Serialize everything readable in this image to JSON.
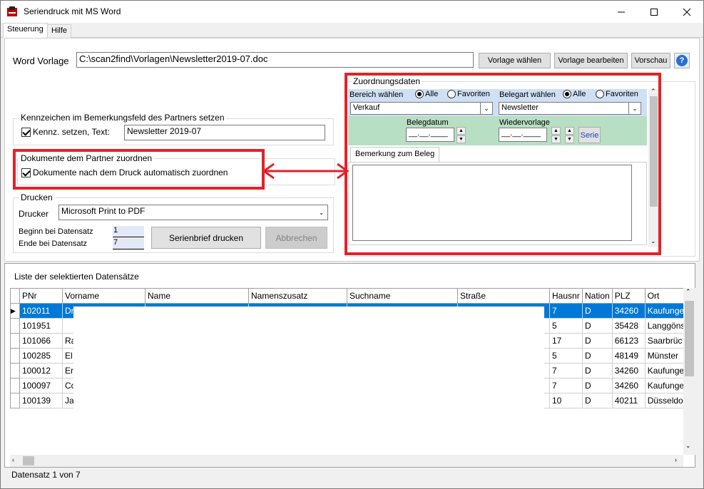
{
  "window": {
    "title": "Seriendruck mit MS Word"
  },
  "tabs": [
    {
      "label": "Steuerung"
    },
    {
      "label": "Hilfe"
    }
  ],
  "vorlage": {
    "label": "Word Vorlage",
    "path": "C:\\scan2find\\Vorlagen\\Newsletter2019-07.doc",
    "btn_waehlen": "Vorlage wählen",
    "btn_bearbeiten": "Vorlage bearbeiten",
    "btn_vorschau": "Vorschau",
    "help": "?"
  },
  "kennzeichen": {
    "group": "Kennzeichen im Bemerkungsfeld des Partners setzen",
    "checkbox": "Kennz. setzen, Text:",
    "text": "Newsletter 2019-07"
  },
  "dokumente": {
    "group": "Dokumente dem Partner zuordnen",
    "checkbox": "Dokumente nach dem Druck automatisch zuordnen"
  },
  "drucken": {
    "group": "Drucken",
    "drucker_label": "Drucker",
    "drucker": "Microsoft Print to PDF",
    "beginn_label": "Beginn bei Datensatz",
    "beginn": "1",
    "ende_label": "Ende bei Datensatz",
    "ende": "7",
    "btn_drucken": "Serienbrief drucken",
    "btn_abbrechen": "Abbrechen"
  },
  "zuordnung": {
    "group": "Zuordnungsdaten",
    "bereich_label": "Bereich wählen",
    "alle": "Alle",
    "favoriten": "Favoriten",
    "bereich": "Verkauf",
    "belegart_label": "Belegart wählen",
    "belegart": "Newsletter",
    "belegdatum_label": "Belegdatum",
    "belegdatum": "__.__.____",
    "wiedervorlage_label": "Wiedervorlage",
    "wiedervorlage": "__.__.____",
    "serie": "Serie",
    "bemerkung_tab": "Bemerkung zum Beleg"
  },
  "liste": {
    "title": "Liste der selektierten Datensätze",
    "columns": [
      "PNr",
      "Vorname",
      "Name",
      "Namenszusatz",
      "Suchname",
      "Straße",
      "Hausnr",
      "Nation",
      "PLZ",
      "Ort"
    ],
    "rows": [
      {
        "pnr": "102011",
        "vorname": "Dr",
        "hausnr": "7",
        "nation": "D",
        "plz": "34260",
        "ort": "Kaufunge"
      },
      {
        "pnr": "101951",
        "vorname": "",
        "hausnr": "5",
        "nation": "D",
        "plz": "35428",
        "ort": "Langgöns"
      },
      {
        "pnr": "101066",
        "vorname": "Ra",
        "hausnr": "17",
        "nation": "D",
        "plz": "66123",
        "ort": "Saarbrüc"
      },
      {
        "pnr": "100285",
        "vorname": "El",
        "hausnr": "5",
        "nation": "D",
        "plz": "48149",
        "ort": "Münster"
      },
      {
        "pnr": "100012",
        "vorname": "Er",
        "hausnr": "7",
        "nation": "D",
        "plz": "34260",
        "ort": "Kaufunge"
      },
      {
        "pnr": "100097",
        "vorname": "Co",
        "hausnr": "7",
        "nation": "D",
        "plz": "34260",
        "ort": "Kaufunge"
      },
      {
        "pnr": "100139",
        "vorname": "Ja",
        "hausnr": "10",
        "nation": "D",
        "plz": "40211",
        "ort": "Düsseldo"
      }
    ]
  },
  "status": {
    "text": "Datensatz 1 von 7"
  },
  "colors": {
    "highlight": "#e32228",
    "selection": "#0078d7",
    "green_band": "#b7dfc3",
    "blue_band": "#cfe0f5"
  }
}
